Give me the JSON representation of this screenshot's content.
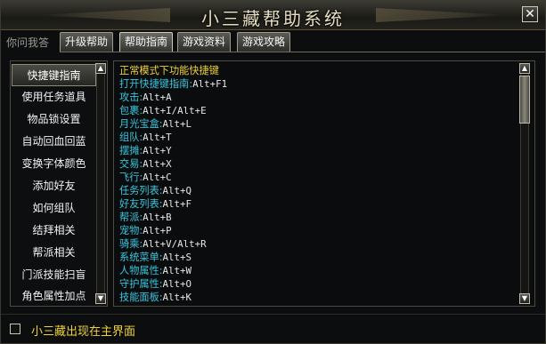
{
  "window": {
    "title": "小三藏帮助系统",
    "close_label": "✕"
  },
  "tabs": {
    "static_label": "你问我答",
    "items": [
      {
        "label": "升级帮助",
        "active": false
      },
      {
        "label": "帮助指南",
        "active": true
      },
      {
        "label": "游戏资料",
        "active": false
      },
      {
        "label": "游戏攻略",
        "active": false
      }
    ]
  },
  "sidebar": {
    "items": [
      {
        "label": "快捷键指南",
        "selected": true
      },
      {
        "label": "使用任务道具",
        "selected": false
      },
      {
        "label": "物品锁设置",
        "selected": false
      },
      {
        "label": "自动回血回蓝",
        "selected": false
      },
      {
        "label": "变换字体颜色",
        "selected": false
      },
      {
        "label": "添加好友",
        "selected": false
      },
      {
        "label": "如何组队",
        "selected": false
      },
      {
        "label": "结拜相关",
        "selected": false
      },
      {
        "label": "帮派相关",
        "selected": false
      },
      {
        "label": "门派技能扫盲",
        "selected": false
      },
      {
        "label": "角色属性加点",
        "selected": false
      }
    ]
  },
  "content": {
    "header": "正常模式下功能快捷键",
    "lines": [
      {
        "name": "打开快捷键指南",
        "keys": "Alt+F1"
      },
      {
        "name": "攻击",
        "keys": "Alt+A"
      },
      {
        "name": "包裹",
        "keys": "Alt+I/Alt+E"
      },
      {
        "name": "月光宝盒",
        "keys": "Alt+L"
      },
      {
        "name": "组队",
        "keys": "Alt+T"
      },
      {
        "name": "摆摊",
        "keys": "Alt+Y"
      },
      {
        "name": "交易",
        "keys": "Alt+X"
      },
      {
        "name": "飞行",
        "keys": "Alt+C"
      },
      {
        "name": "任务列表",
        "keys": "Alt+Q"
      },
      {
        "name": "好友列表",
        "keys": "Alt+F"
      },
      {
        "name": "帮派",
        "keys": "Alt+B"
      },
      {
        "name": "宠物",
        "keys": "Alt+P"
      },
      {
        "name": "骑乘",
        "keys": "Alt+V/Alt+R"
      },
      {
        "name": "系统菜单",
        "keys": "Alt+S"
      },
      {
        "name": "人物属性",
        "keys": "Alt+W"
      },
      {
        "name": "守护属性",
        "keys": "Alt+O"
      },
      {
        "name": "技能面板",
        "keys": "Alt+K"
      }
    ]
  },
  "footer": {
    "checkbox_label": "小三藏出现在主界面",
    "checked": false
  },
  "colors": {
    "header": "#f0d23c",
    "shortcut_name": "#38c7e0",
    "shortcut_keys": "#e6e6e6",
    "footer_text": "#f0d23c"
  },
  "icons": {
    "scroll_up": "triangle-up-icon",
    "scroll_down": "triangle-down-icon",
    "close": "close-icon"
  }
}
